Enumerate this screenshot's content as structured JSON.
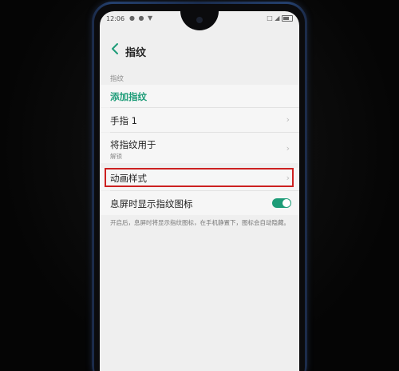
{
  "status_bar": {
    "time": "12:06",
    "left_icons": "● ● ▼",
    "right_icons": "□ ◢"
  },
  "header": {
    "back_icon": "chevron-left-icon",
    "title": "指纹"
  },
  "section": {
    "label": "指纹"
  },
  "items": {
    "add_fingerprint": "添加指纹",
    "finger_1": "手指 1",
    "use_fingerprint_for": {
      "label": "将指纹用于",
      "sub": "解锁"
    },
    "animation_style": "动画样式",
    "show_icon_screen_off": {
      "label": "息屏时显示指纹图标",
      "toggle_on": true
    }
  },
  "description": "开启后，息屏时将显示指纹图标，在手机静置下，图标会自动隐藏。",
  "colors": {
    "accent": "#1e9c78",
    "highlight": "#cc2020",
    "background": "#efefef"
  }
}
